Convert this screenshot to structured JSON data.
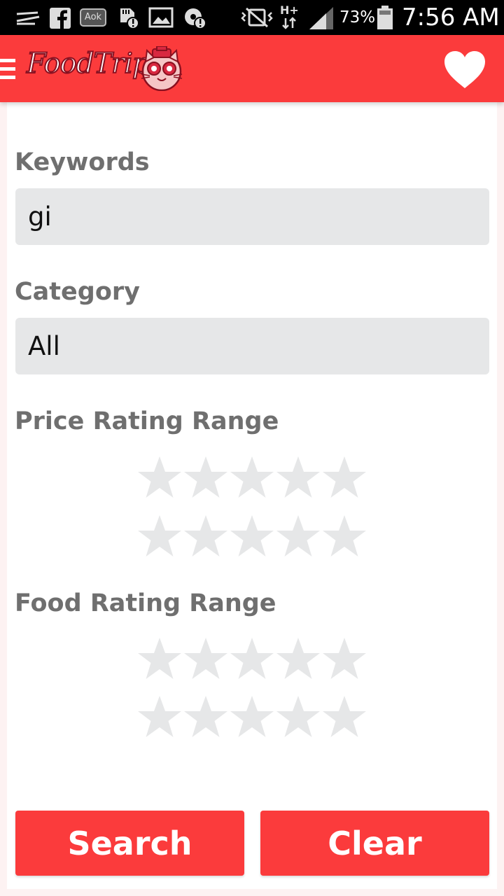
{
  "status_bar": {
    "battery_percent": "73%",
    "time": "7:56 AM",
    "icons": [
      "zing-icon",
      "facebook-icon",
      "aok-icon",
      "sd-card-alert-icon",
      "image-icon",
      "storage-alert-icon",
      "mute-vibrate-icon",
      "hplus-data-icon",
      "signal-icon",
      "battery-icon"
    ],
    "icon_label_aok": "Aok",
    "network_label": "H+"
  },
  "app_bar": {
    "logo_text": "FoodTrip",
    "background": "#fb3b3c",
    "icons": [
      "menu-icon",
      "heart-icon"
    ]
  },
  "form": {
    "keywords": {
      "label": "Keywords",
      "value": "gi"
    },
    "category": {
      "label": "Category",
      "value": "All"
    },
    "price_rating": {
      "label": "Price Rating Range",
      "min_stars": 0,
      "max_stars": 0,
      "out_of": 5
    },
    "food_rating": {
      "label": "Food Rating Range",
      "min_stars": 0,
      "max_stars": 0,
      "out_of": 5
    }
  },
  "buttons": {
    "search_label": "Search",
    "clear_label": "Clear"
  },
  "colors": {
    "accent": "#fb3b3c",
    "field_bg": "#e6e7e8",
    "star_empty": "#e6e7e8",
    "label_text": "#6f6f6f"
  }
}
